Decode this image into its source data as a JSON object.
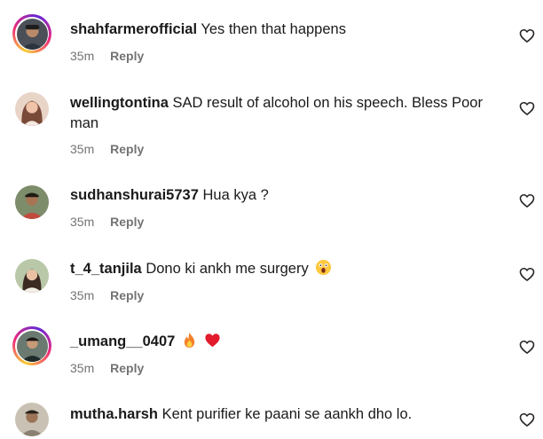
{
  "comments": [
    {
      "username": "shahfarmerofficial",
      "text": "Yes then that happens",
      "time": "35m",
      "reply": "Reply"
    },
    {
      "username": "wellingtontina",
      "text": "SAD result of alcohol on his speech. Bless Poor man",
      "time": "35m",
      "reply": "Reply"
    },
    {
      "username": "sudhanshurai5737",
      "text": "Hua kya ?",
      "time": "35m",
      "reply": "Reply"
    },
    {
      "username": "t_4_tanjila",
      "text": "Dono ki ankh me surgery",
      "time": "35m",
      "reply": "Reply"
    },
    {
      "username": "_umang__0407",
      "text": "",
      "time": "35m",
      "reply": "Reply"
    },
    {
      "username": "mutha.harsh",
      "text": "Kent purifier ke paani se aankh dho lo.",
      "time": "",
      "reply": ""
    }
  ],
  "icons": {
    "like": "heart-outline-icon",
    "emoji_shocked": "face-screaming-emoji",
    "emoji_fire": "fire-emoji",
    "emoji_heart": "red-heart-emoji"
  },
  "colors": {
    "meta": "#737373",
    "story_ring": "#ee2a7b"
  }
}
